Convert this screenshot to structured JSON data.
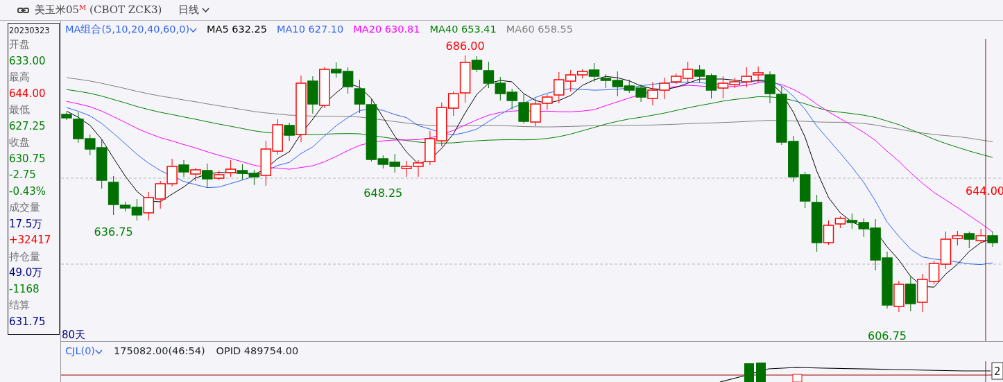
{
  "window": {
    "title": "美玉米05",
    "title_sup": "M",
    "symbol": "(CBOT ZCK3)",
    "period": "日线"
  },
  "info_panel": {
    "date": "20230323",
    "rows": [
      {
        "text": "开盘",
        "color": "#707070"
      },
      {
        "text": "633.00",
        "color": "#008000"
      },
      {
        "text": "最高",
        "color": "#707070"
      },
      {
        "text": "644.00",
        "color": "#ff0000"
      },
      {
        "text": "最低",
        "color": "#707070"
      },
      {
        "text": "627.25",
        "color": "#008000"
      },
      {
        "text": "收盘",
        "color": "#707070"
      },
      {
        "text": "630.75",
        "color": "#008000"
      },
      {
        "text": "-2.75",
        "color": "#008000"
      },
      {
        "text": "-0.43%",
        "color": "#008000"
      },
      {
        "text": "成交量",
        "color": "#707070"
      },
      {
        "text": "17.5万",
        "color": "#000080"
      },
      {
        "text": "+32417",
        "color": "#ff0000"
      },
      {
        "text": "持仓量",
        "color": "#707070"
      },
      {
        "text": "49.0万",
        "color": "#000080"
      },
      {
        "text": "-1168",
        "color": "#008000"
      },
      {
        "text": "结算",
        "color": "#707070"
      },
      {
        "text": "631.75",
        "color": "#000080"
      }
    ]
  },
  "ma_legend": {
    "label": "MA组合(5,10,20,40,60,0)",
    "items": [
      {
        "text": "MA5 632.25",
        "color": "#000000"
      },
      {
        "text": "MA10 627.10",
        "color": "#3366ee"
      },
      {
        "text": "MA20 630.81",
        "color": "#ff00ff"
      },
      {
        "text": "MA40 653.41",
        "color": "#008000"
      },
      {
        "text": "MA60 658.55",
        "color": "#808080"
      }
    ]
  },
  "price_labels": [
    {
      "text": "686.00",
      "color": "#ff0000"
    },
    {
      "text": "648.25",
      "color": "#008000"
    },
    {
      "text": "636.75",
      "color": "#008000"
    },
    {
      "text": "606.75",
      "color": "#008000"
    },
    {
      "text": "644.00",
      "color": "#ff0000"
    }
  ],
  "range_label": "80天",
  "volume_panel": {
    "label": "CJL(0)",
    "readings": [
      "175082.00(46:54)",
      "OPID 489754.00"
    ],
    "axis_label": "2"
  }
}
